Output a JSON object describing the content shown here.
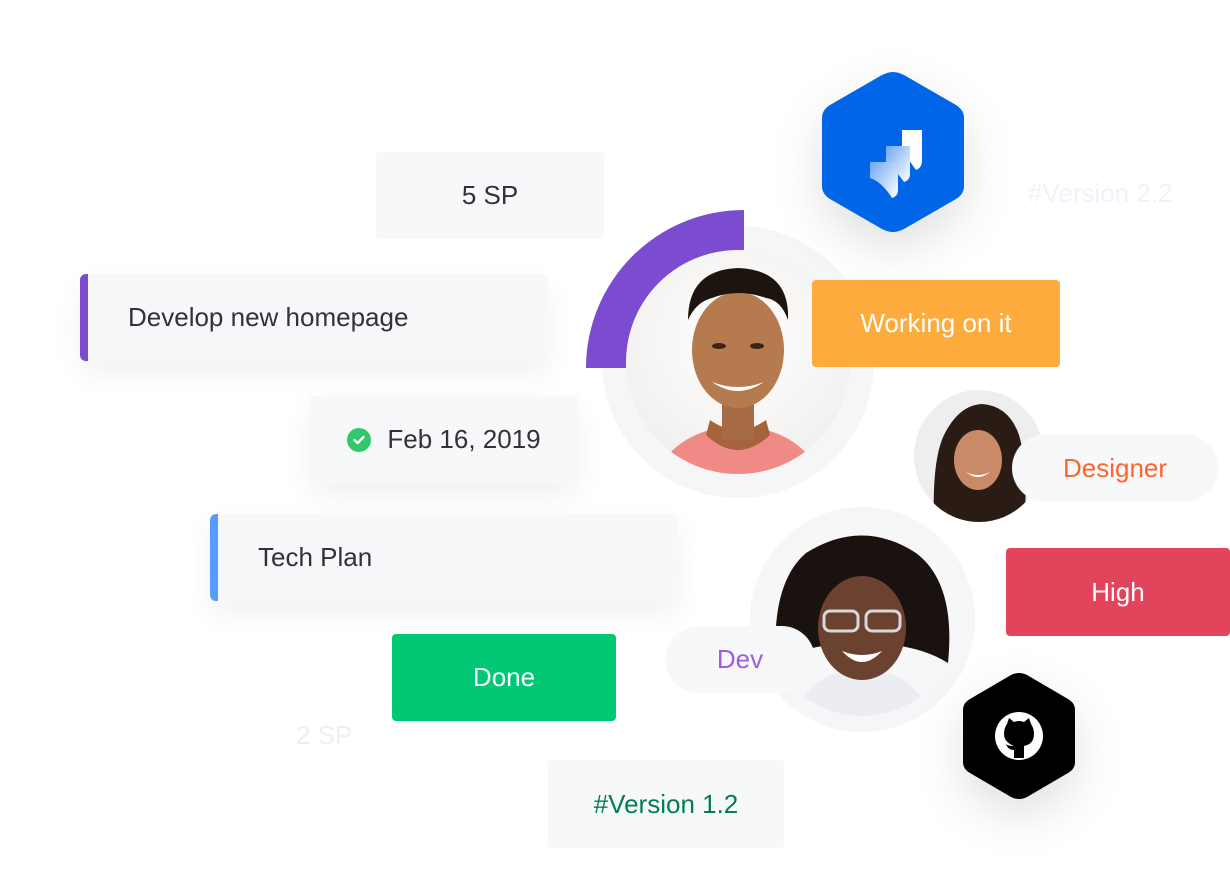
{
  "colors": {
    "purple": "#7b4bd0",
    "blue_border": "#579bfc",
    "done_green": "#00c875",
    "working_orange": "#fdab3d",
    "high_red": "#e2445c",
    "designer_orange": "#ff642e",
    "dev_purple": "#a25ddc",
    "version_green": "#037f4c",
    "jira_blue": "#0065e6",
    "github_black": "#000000",
    "ghost_text": "#eef1f4",
    "ghost_version": "#eef3fb",
    "card_bg": "#f7f8fa",
    "ring_bg": "#f5f6f8",
    "check_green": "#33c76b"
  },
  "cards": {
    "story_points_top": "5 SP",
    "task_homepage": "Develop new homepage",
    "due_date": "Feb 16, 2019",
    "task_tech_plan": "Tech Plan",
    "version_bottom": "#Version 1.2"
  },
  "statuses": {
    "done": "Done",
    "working": "Working on it",
    "priority_high": "High"
  },
  "ghost_labels": {
    "version_top": "#Version 2.2",
    "story_points_bottom": "2 SP"
  },
  "roles": {
    "designer": "Designer",
    "dev": "Dev"
  },
  "progress": {
    "main_avatar_ring_fraction": 0.25
  },
  "icons": {
    "jira": "jira-logo-icon",
    "github": "github-logo-icon",
    "check": "check-circle-icon"
  }
}
